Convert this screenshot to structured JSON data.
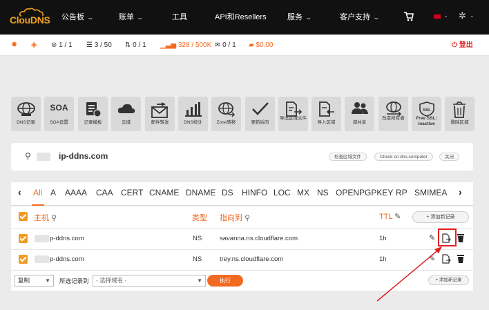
{
  "brand": {
    "name": "ClouDNS"
  },
  "nav": {
    "items": [
      {
        "label": "公告板",
        "has_caret": true
      },
      {
        "label": "账单",
        "has_caret": true
      },
      {
        "label": "工具",
        "has_caret": false
      },
      {
        "label": "API和Resellers",
        "has_caret": false
      },
      {
        "label": "服务",
        "has_caret": true
      },
      {
        "label": "客户支持",
        "has_caret": true
      }
    ]
  },
  "status": {
    "records": "1 / 1",
    "zones": "3 / 50",
    "transfers": "0 / 1",
    "stats": "328 / 500K",
    "mail": "0 / 1",
    "balance": "$0.00",
    "logout": "登出"
  },
  "tools": [
    {
      "label": "DNS记录",
      "icon": "globe-icon"
    },
    {
      "label": "SOA设置",
      "icon": "soa-text-icon",
      "text": "SOA"
    },
    {
      "label": "记录模板",
      "icon": "template-icon"
    },
    {
      "label": "云域",
      "icon": "cloud-icon"
    },
    {
      "label": "邮件转发",
      "icon": "envelope-icon"
    },
    {
      "label": "DNS统计",
      "icon": "bar-chart-icon"
    },
    {
      "label": "Zone转移",
      "icon": "globe-transfer-icon"
    },
    {
      "label": "更新后的",
      "icon": "checkmark-icon"
    },
    {
      "label": "导出区域文件",
      "icon": "export-file-icon"
    },
    {
      "label": "导入区域",
      "icon": "import-file-icon"
    },
    {
      "label": "域共享",
      "icon": "users-icon"
    },
    {
      "label": "改变所有者",
      "icon": "owner-change-icon"
    },
    {
      "label": "Free SSL: inactive",
      "icon": "ssl-shield-icon",
      "text": "SSL"
    },
    {
      "label": "删除区域",
      "icon": "trash-icon"
    }
  ],
  "zone": {
    "domain": "ip-ddns.com",
    "actions": [
      "检查区域文件",
      "Check on dns.computer",
      "关闭"
    ]
  },
  "tabs": [
    "All",
    "A",
    "AAAA",
    "CAA",
    "CERT",
    "CNAME",
    "DNAME",
    "DS",
    "HINFO",
    "LOC",
    "MX",
    "NS",
    "OPENPGPKEY",
    "RP",
    "SMIMEA"
  ],
  "table": {
    "headers": {
      "host": "主机",
      "type": "类型",
      "points_to": "指向到",
      "ttl": "TTL"
    },
    "add_label": "+ 添加新记录",
    "rows": [
      {
        "host": "p-ddns.com",
        "type": "NS",
        "points_to": "savanna.ns.cloudflare.com",
        "ttl": "1h"
      },
      {
        "host": "p-ddns.com",
        "type": "NS",
        "points_to": "trey.ns.cloudflare.com",
        "ttl": "1h"
      }
    ]
  },
  "bulk": {
    "action_value": "复制",
    "selected_label": "所选记录到",
    "domain_placeholder": "- 选择域名 -",
    "exec_label": "执行",
    "add_label": "+ 添加新记录"
  },
  "colors": {
    "accent": "#f26a21",
    "nav_bg": "#111111",
    "highlight": "#e02020"
  }
}
